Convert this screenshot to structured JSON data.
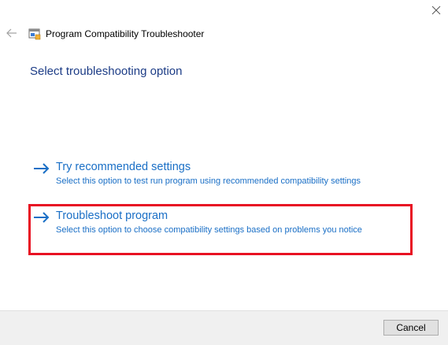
{
  "window": {
    "title": "Program Compatibility Troubleshooter",
    "icons": {
      "back": "back-arrow-icon",
      "close": "close-icon",
      "app": "troubleshooter-app-icon"
    }
  },
  "main": {
    "heading": "Select troubleshooting option",
    "options": [
      {
        "title": "Try recommended settings",
        "description": "Select this option to test run program using recommended compatibility settings",
        "icon": "arrow-right-icon"
      },
      {
        "title": "Troubleshoot program",
        "description": "Select this option to choose compatibility settings based on problems you notice",
        "icon": "arrow-right-icon",
        "highlighted": true
      }
    ]
  },
  "footer": {
    "cancel_label": "Cancel"
  },
  "colors": {
    "link": "#1a6fc6",
    "heading": "#1c3c86",
    "highlight": "#e81123",
    "footer_bg": "#f0f0f0"
  }
}
